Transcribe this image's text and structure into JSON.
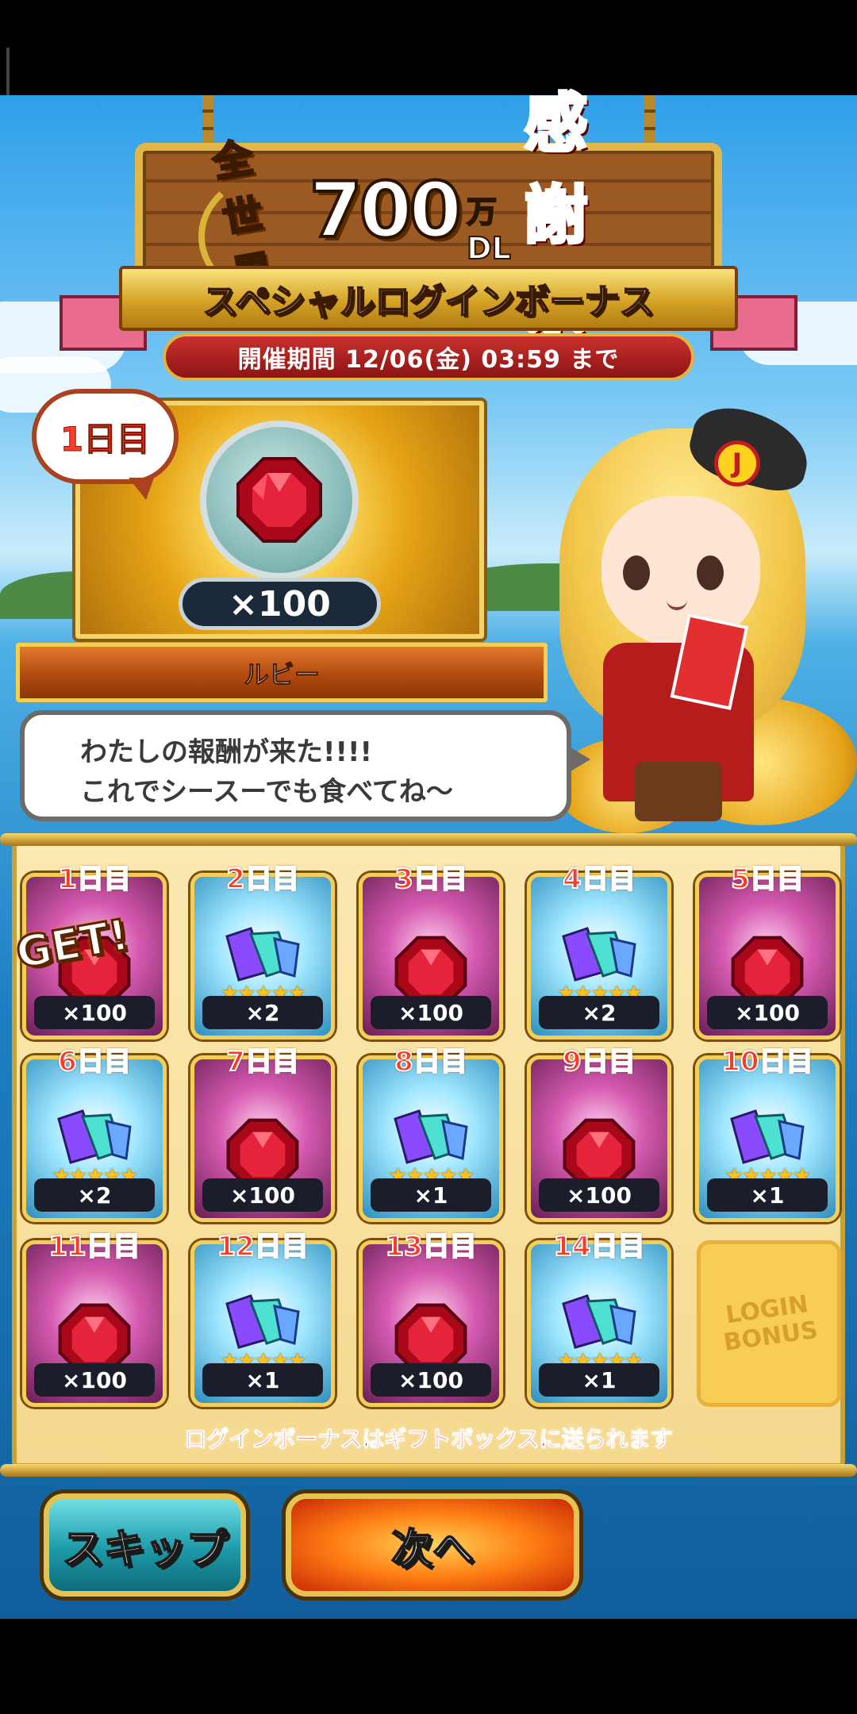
{
  "event": {
    "logo_prefix": "全世界",
    "logo_number": "700",
    "logo_unit": "万DL",
    "logo_suffix": "感謝祭",
    "title": "スペシャルログインボーナス",
    "period": "開催期間 12/06(金) 03:59 まで"
  },
  "today_reward": {
    "day_label": "1日目",
    "quantity": "×100",
    "item_name": "ルビー",
    "item_icon": "ruby-icon"
  },
  "dialogue": {
    "line1": "わたしの報酬が来た!!!!",
    "line2": "これでシースーでも食べてね～"
  },
  "calendar": [
    {
      "day": "1日目",
      "amount": "×100",
      "type": "ruby",
      "claimed": true
    },
    {
      "day": "2日目",
      "amount": "×2",
      "type": "crystal"
    },
    {
      "day": "3日目",
      "amount": "×100",
      "type": "ruby"
    },
    {
      "day": "4日目",
      "amount": "×2",
      "type": "crystal"
    },
    {
      "day": "5日目",
      "amount": "×100",
      "type": "ruby"
    },
    {
      "day": "6日目",
      "amount": "×2",
      "type": "crystal"
    },
    {
      "day": "7日目",
      "amount": "×100",
      "type": "ruby"
    },
    {
      "day": "8日目",
      "amount": "×1",
      "type": "crystal"
    },
    {
      "day": "9日目",
      "amount": "×100",
      "type": "ruby"
    },
    {
      "day": "10日目",
      "amount": "×1",
      "type": "crystal"
    },
    {
      "day": "11日目",
      "amount": "×100",
      "type": "ruby"
    },
    {
      "day": "12日目",
      "amount": "×1",
      "type": "crystal"
    },
    {
      "day": "13日目",
      "amount": "×100",
      "type": "ruby"
    },
    {
      "day": "14日目",
      "amount": "×1",
      "type": "crystal"
    }
  ],
  "claimed_badge": "GET!",
  "login_stamp": "LOGIN BONUS",
  "stars": "★★★★★",
  "note": "ログインボーナスはギフトボックスに送られます",
  "buttons": {
    "skip": "スキップ",
    "next": "次へ"
  },
  "character_badge": "J"
}
